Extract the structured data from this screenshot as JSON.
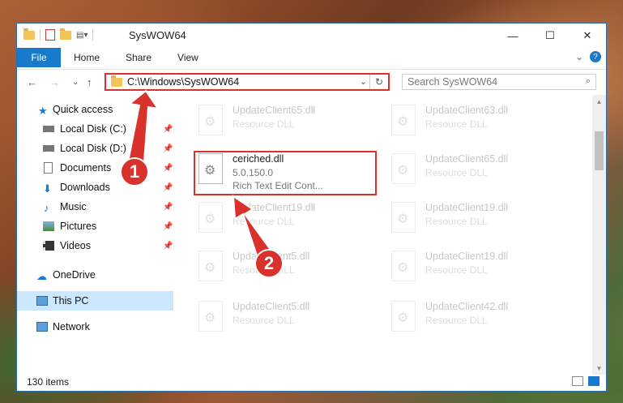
{
  "window": {
    "title": "SysWOW64",
    "minimize": "—",
    "maximize": "☐",
    "close": "✕"
  },
  "ribbon": {
    "tabs": [
      "File",
      "Home",
      "Share",
      "View"
    ],
    "chevron": "⌄",
    "help": "?"
  },
  "nav": {
    "back": "←",
    "forward": "→",
    "recent": "⌄",
    "up": "↑",
    "address": "C:\\Windows\\SysWOW64",
    "address_dropdown": "⌄",
    "refresh": "↻",
    "search_placeholder": "Search SysWOW64",
    "search_icon": "⌕"
  },
  "sidebar": {
    "items": [
      {
        "label": "Quick access",
        "icon": "star-icon",
        "pinned": false
      },
      {
        "label": "Local Disk (C:)",
        "icon": "drive-icon",
        "pinned": true
      },
      {
        "label": "Local Disk (D:)",
        "icon": "drive-icon",
        "pinned": true
      },
      {
        "label": "Documents",
        "icon": "documents-icon",
        "pinned": true
      },
      {
        "label": "Downloads",
        "icon": "downloads-icon",
        "pinned": true
      },
      {
        "label": "Music",
        "icon": "music-icon",
        "pinned": true
      },
      {
        "label": "Pictures",
        "icon": "pictures-icon",
        "pinned": true
      },
      {
        "label": "Videos",
        "icon": "videos-icon",
        "pinned": true
      },
      {
        "label": "OneDrive",
        "icon": "cloud-icon",
        "pinned": false
      },
      {
        "label": "This PC",
        "icon": "computer-icon",
        "pinned": false,
        "selected": true
      },
      {
        "label": "Network",
        "icon": "network-icon",
        "pinned": false
      }
    ],
    "pin_glyph": "📌"
  },
  "files": [
    {
      "name": "UpdateClient65.dll",
      "sub": "Resource DLL",
      "faded": true
    },
    {
      "name": "UpdateClient63.dll",
      "sub": "Resource DLL",
      "faded": true
    },
    {
      "name": "ceriched.dll",
      "sub": "5.0.150.0",
      "sub2": "Rich Text Edit Cont...",
      "faded": false
    },
    {
      "name": "UpdateClient65.dll",
      "sub": "Resource DLL",
      "faded": true
    },
    {
      "name": "UpdateClient19.dll",
      "sub": "Resource DLL",
      "faded": true
    },
    {
      "name": "UpdateClient19.dll",
      "sub": "Resource DLL",
      "faded": true
    },
    {
      "name": "UpdateClient5.dll",
      "sub": "Resource DLL",
      "faded": true
    },
    {
      "name": "UpdateClient19.dll",
      "sub": "Resource DLL",
      "faded": true
    },
    {
      "name": "UpdateClient5.dll",
      "sub": "Resource DLL",
      "faded": true
    },
    {
      "name": "UpdateClient42.dll",
      "sub": "Resource DLL",
      "faded": true
    }
  ],
  "status": {
    "item_count": "130 items"
  },
  "callouts": [
    "1",
    "2"
  ],
  "colors": {
    "accent": "#1979ca",
    "callout": "#d9312b",
    "selected": "#cce8ff"
  }
}
